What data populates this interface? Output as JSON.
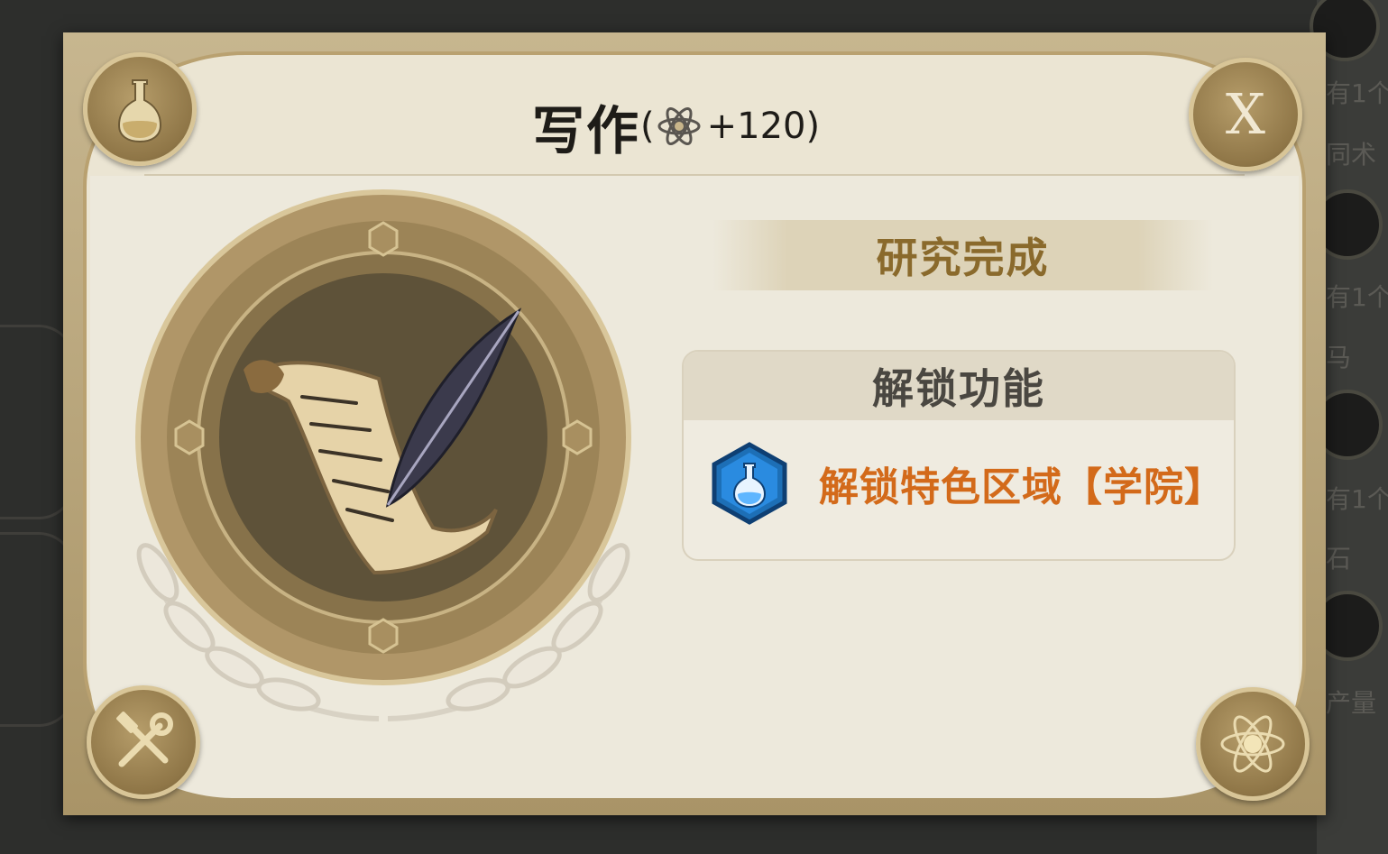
{
  "dialog": {
    "title": "写作",
    "bonus_open": "(",
    "bonus_value": "+120",
    "bonus_close": ")",
    "close_label": "X",
    "status": "研究完成",
    "unlock_header": "解锁功能",
    "unlock_item": "解锁特色区域【学院】"
  },
  "background": {
    "side_texts": [
      "有1个",
      "同术",
      "有1个",
      "马",
      "有1个",
      "石",
      "产量"
    ]
  },
  "icons": {
    "top_left": "flask-icon",
    "top_right": "close-icon",
    "bottom_left": "tools-icon",
    "bottom_right": "atom-icon",
    "center": "scroll-quill-icon",
    "unlock": "blue-flask-hex-icon"
  },
  "colors": {
    "status_text": "#8a6a2c",
    "unlock_text": "#d36a1a",
    "frame_gold": "#b9a170"
  }
}
